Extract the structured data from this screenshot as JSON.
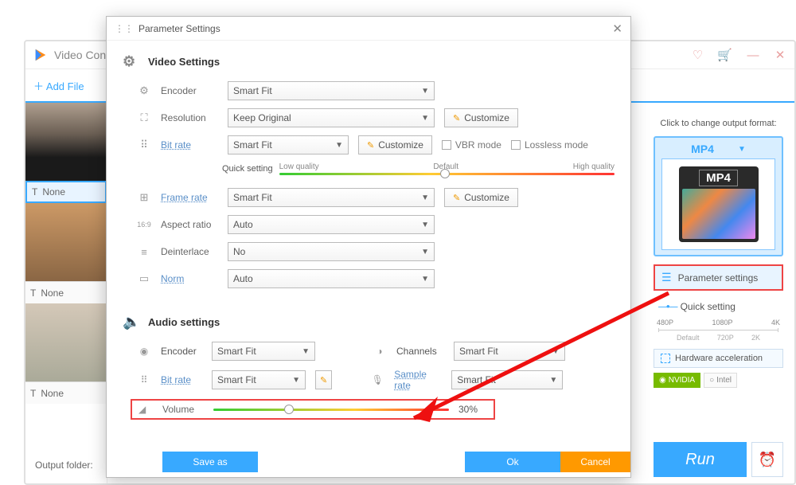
{
  "bgWindow": {
    "title": "Video Conv",
    "addFile": "Add File",
    "none": "None",
    "outputFolder": "Output folder:"
  },
  "rightPanel": {
    "hint": "Click to change output format:",
    "format": "MP4",
    "formatBoxLabel": "MP4",
    "paramSettings": "Parameter settings",
    "quickSetting": "Quick setting",
    "scaleTop": {
      "a": "480P",
      "b": "1080P",
      "c": "4K"
    },
    "scaleBot": {
      "a": "Default",
      "b": "720P",
      "c": "2K"
    },
    "hwAccel": "Hardware acceleration",
    "nvidia": "NVIDIA",
    "intel": "Intel",
    "run": "Run"
  },
  "modal": {
    "title": "Parameter Settings",
    "sections": {
      "video": "Video Settings",
      "audio": "Audio settings"
    },
    "labels": {
      "encoder": "Encoder",
      "resolution": "Resolution",
      "bitrate": "Bit rate",
      "quickSetting": "Quick setting",
      "lowQ": "Low quality",
      "default": "Default",
      "highQ": "High quality",
      "frameRate": "Frame rate",
      "aspect": "Aspect ratio",
      "deinterlace": "Deinterlace",
      "norm": "Norm",
      "channels": "Channels",
      "sample": "Sample rate",
      "volume": "Volume",
      "customize": "Customize",
      "vbr": "VBR mode",
      "lossless": "Lossless mode"
    },
    "values": {
      "encoder": "Smart Fit",
      "resolution": "Keep Original",
      "bitrate": "Smart Fit",
      "frameRate": "Smart Fit",
      "aspect": "Auto",
      "deinterlace": "No",
      "norm": "Auto",
      "aEncoder": "Smart Fit",
      "aBitrate": "Smart Fit",
      "channels": "Smart Fit",
      "sample": "Smart Fit",
      "volumePercent": "30%"
    },
    "buttons": {
      "saveAs": "Save as",
      "ok": "Ok",
      "cancel": "Cancel"
    }
  }
}
